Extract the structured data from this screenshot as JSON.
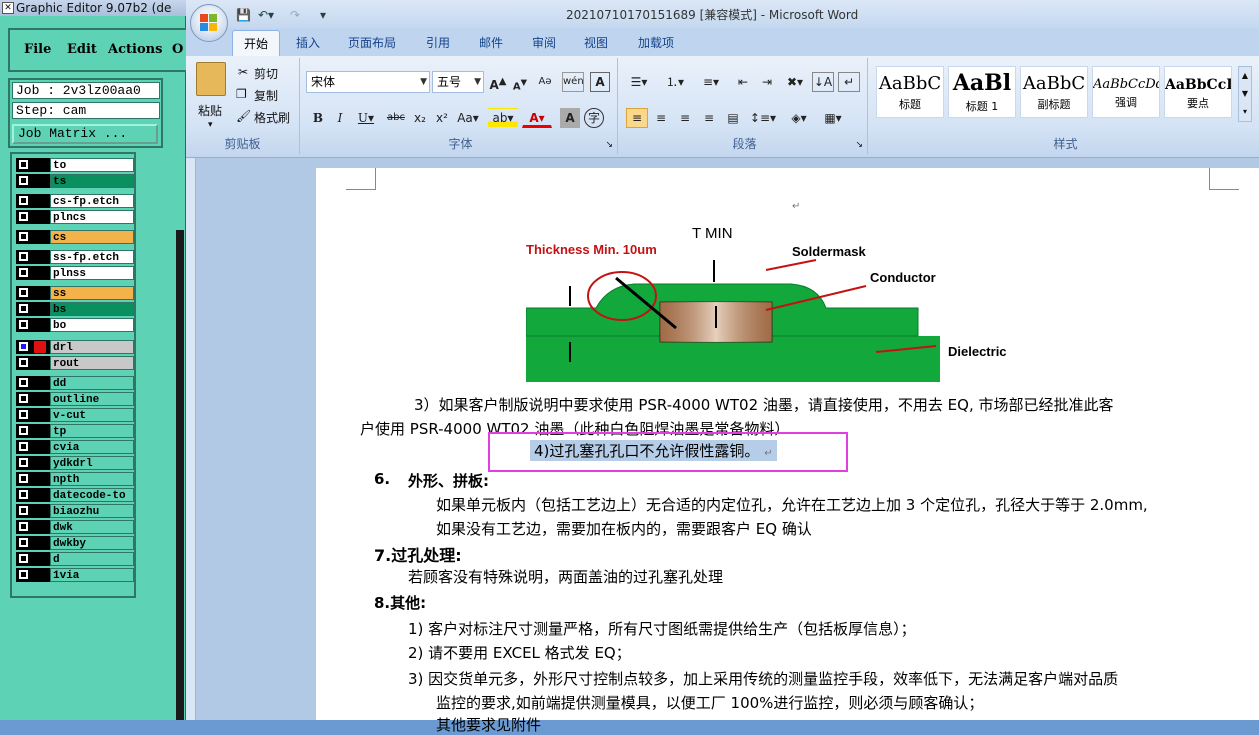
{
  "graphic_editor": {
    "title": "Graphic Editor 9.07b2 (de",
    "menu": [
      "File",
      "Edit",
      "Actions",
      "O"
    ],
    "job_line": "Job : 2v3lz00aa0",
    "step_line": "Step: cam",
    "job_matrix_label": "Job Matrix ...",
    "layers": [
      {
        "name": "to",
        "color": "#ffffff"
      },
      {
        "name": "ts",
        "color": "#0a8f5e"
      },
      {
        "name": "cs-fp.etch",
        "color": "#ffffff"
      },
      {
        "name": "plncs",
        "color": "#ffffff"
      },
      {
        "name": "cs",
        "color": "#f3b24a"
      },
      {
        "name": "ss-fp.etch",
        "color": "#ffffff"
      },
      {
        "name": "plnss",
        "color": "#ffffff"
      },
      {
        "name": "ss",
        "color": "#f3b24a"
      },
      {
        "name": "bs",
        "color": "#0a8f5e"
      },
      {
        "name": "bo",
        "color": "#ffffff"
      },
      {
        "name": "drl",
        "color": "#c8c8c8"
      },
      {
        "name": "rout",
        "color": "#c8c8c8"
      },
      {
        "name": "dd",
        "color": "#5ed2b5"
      },
      {
        "name": "outline",
        "color": "#5ed2b5"
      },
      {
        "name": "v-cut",
        "color": "#5ed2b5"
      },
      {
        "name": "tp",
        "color": "#5ed2b5"
      },
      {
        "name": "cvia",
        "color": "#5ed2b5"
      },
      {
        "name": "ydkdrl",
        "color": "#5ed2b5"
      },
      {
        "name": "npth",
        "color": "#5ed2b5"
      },
      {
        "name": "datecode-to",
        "color": "#5ed2b5"
      },
      {
        "name": "biaozhu",
        "color": "#5ed2b5"
      },
      {
        "name": "dwk",
        "color": "#5ed2b5"
      },
      {
        "name": "dwkby",
        "color": "#5ed2b5"
      },
      {
        "name": "d",
        "color": "#5ed2b5"
      },
      {
        "name": "1via",
        "color": "#5ed2b5"
      }
    ]
  },
  "word": {
    "title": "20210710170151689 [兼容模式] - Microsoft Word",
    "tabs": [
      "开始",
      "插入",
      "页面布局",
      "引用",
      "邮件",
      "审阅",
      "视图",
      "加载项"
    ],
    "clipboard": {
      "paste": "粘贴",
      "cut": "剪切",
      "copy": "复制",
      "format_painter": "格式刷",
      "label": "剪贴板"
    },
    "font": {
      "name": "宋体",
      "size": "五号",
      "label": "字体"
    },
    "paragraph": {
      "label": "段落"
    },
    "styles": {
      "label": "样式",
      "items": [
        {
          "sample": "AaBbC",
          "name": "标题"
        },
        {
          "sample": "AaBl",
          "name": "标题 1"
        },
        {
          "sample": "AaBbC",
          "name": "副标题"
        },
        {
          "sample": "AaBbCcDd",
          "name": "强调"
        },
        {
          "sample": "AaBbCcD",
          "name": "要点"
        }
      ]
    },
    "figure": {
      "t_min": "T MIN",
      "thickness": "Thickness Min. 10um",
      "soldermask": "Soldermask",
      "conductor": "Conductor",
      "dielectric": "Dielectric"
    },
    "doc": {
      "p3_line1": "3）如果客户制版说明中要求使用 PSR-4000 WT02 油墨，请直接使用，不用去 EQ, 市场部已经批准此客",
      "p3_line2": "户使用 PSR-4000 WT02 油墨（此种白色阻焊油墨是常备物料）",
      "p4": "4)过孔塞孔孔口不允许假性露铜。",
      "s6_num": "6.",
      "s6_title": "外形、拼板:",
      "s6_l1": "如果单元板内（包括工艺边上）无合适的内定位孔，允许在工艺边上加 3 个定位孔，孔径大于等于 2.0mm,",
      "s6_l2": "如果没有工艺边，需要加在板内的，需要跟客户 EQ 确认",
      "s7_title": "7.过孔处理:",
      "s7_l1": "若顾客没有特殊说明，两面盖油的过孔塞孔处理",
      "s8_title": "8.其他:",
      "s8_1": "1)  客户对标注尺寸测量严格，所有尺寸图纸需提供给生产（包括板厚信息）；",
      "s8_2": "2)  请不要用 EXCEL 格式发 EQ；",
      "s8_3a": "3)  因交货单元多，外形尺寸控制点较多，加上采用传统的测量监控手段，效率低下，无法满足客户端对品质",
      "s8_3b": "监控的要求,如前端提供测量模具，以便工厂 100%进行监控，则必须与顾客确认；",
      "s8_4": "其他要求见附件"
    }
  }
}
